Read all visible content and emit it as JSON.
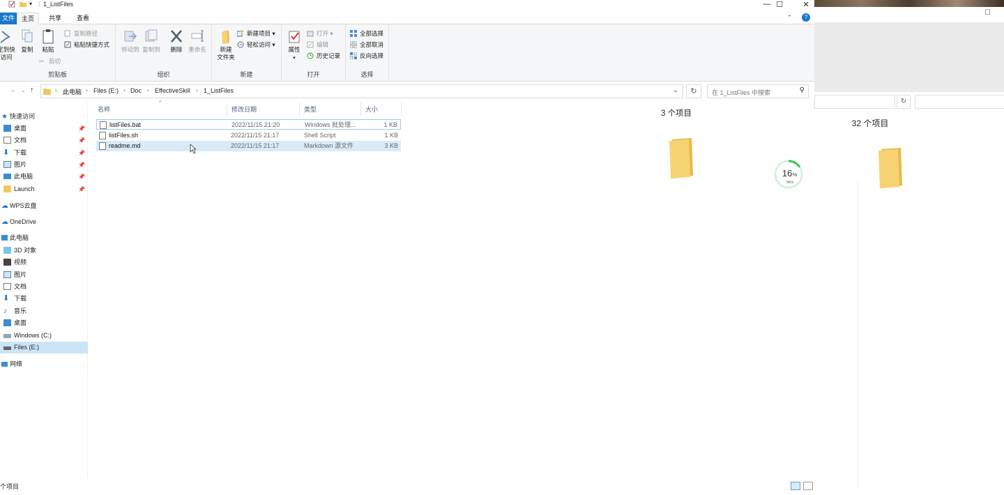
{
  "window": {
    "title": "1_ListFiles",
    "controls": [
      "—",
      "☐",
      "✕"
    ],
    "help": "?"
  },
  "tabs": {
    "file": "文件",
    "home": "主页",
    "share": "共享",
    "view": "查看"
  },
  "ribbon": {
    "clipboard": {
      "group_label": "剪贴板",
      "pin_quick": "固定到快速访问",
      "pin_quick_line1": "定到快",
      "pin_quick_line2": "访问",
      "copy": "复制",
      "paste": "粘贴",
      "copy_path": "复制路径",
      "paste_shortcut": "粘贴快捷方式",
      "cut": "剪切"
    },
    "organize": {
      "group_label": "组织",
      "move_to": "移动到",
      "copy_to": "复制到",
      "delete": "删除",
      "rename": "重命名"
    },
    "new": {
      "group_label": "新建",
      "new_folder_1": "新建",
      "new_folder_2": "文件夹",
      "new_item": "新建项目",
      "easy_access": "轻松访问"
    },
    "open": {
      "group_label": "打开",
      "properties": "属性",
      "open": "打开",
      "edit": "编辑",
      "history": "历史记录"
    },
    "select": {
      "group_label": "选择",
      "select_all": "全部选择",
      "select_none": "全部取消",
      "invert": "反向选择"
    }
  },
  "breadcrumb": [
    "此电脑",
    "Files (E:)",
    "Doc",
    "EffectiveSkill",
    "1_ListFiles"
  ],
  "search": {
    "placeholder": "在 1_ListFiles 中搜索"
  },
  "nav": {
    "quick_access": "快速访问",
    "quick_items": [
      "桌面",
      "文档",
      "下载",
      "图片",
      "此电脑",
      "Launch"
    ],
    "wps": "WPS云盘",
    "onedrive": "OneDrive",
    "this_pc": "此电脑",
    "pc_items": [
      "3D 对象",
      "视频",
      "图片",
      "文档",
      "下载",
      "音乐",
      "桌面",
      "Windows (C:)",
      "Files (E:)"
    ],
    "network": "网络"
  },
  "columns": {
    "name": "名称",
    "date": "修改日期",
    "type": "类型",
    "size": "大小"
  },
  "files": [
    {
      "name": "listFiles.bat",
      "date": "2022/11/15 21:20",
      "type": "Windows 批处理...",
      "size": "1 KB"
    },
    {
      "name": "listFiles.sh",
      "date": "2022/11/15 21:17",
      "type": "Shell Script",
      "size": "1 KB"
    },
    {
      "name": "readme.md",
      "date": "2022/11/15 21:17",
      "type": "Markdown 源文件",
      "size": "3 KB"
    }
  ],
  "preview": {
    "item_count": "3 个项目"
  },
  "gauge": {
    "percent": "16",
    "percent_sign": "%",
    "speed": "0K/s",
    "value": 0.16
  },
  "status": {
    "count": "个项目"
  },
  "background_window": {
    "item_count": "32 个项目",
    "control": "☐"
  },
  "colors": {
    "accent": "#1979ca",
    "selected": "#cce4f7",
    "folder": "#f0c862",
    "gauge": "#3cc15b"
  }
}
